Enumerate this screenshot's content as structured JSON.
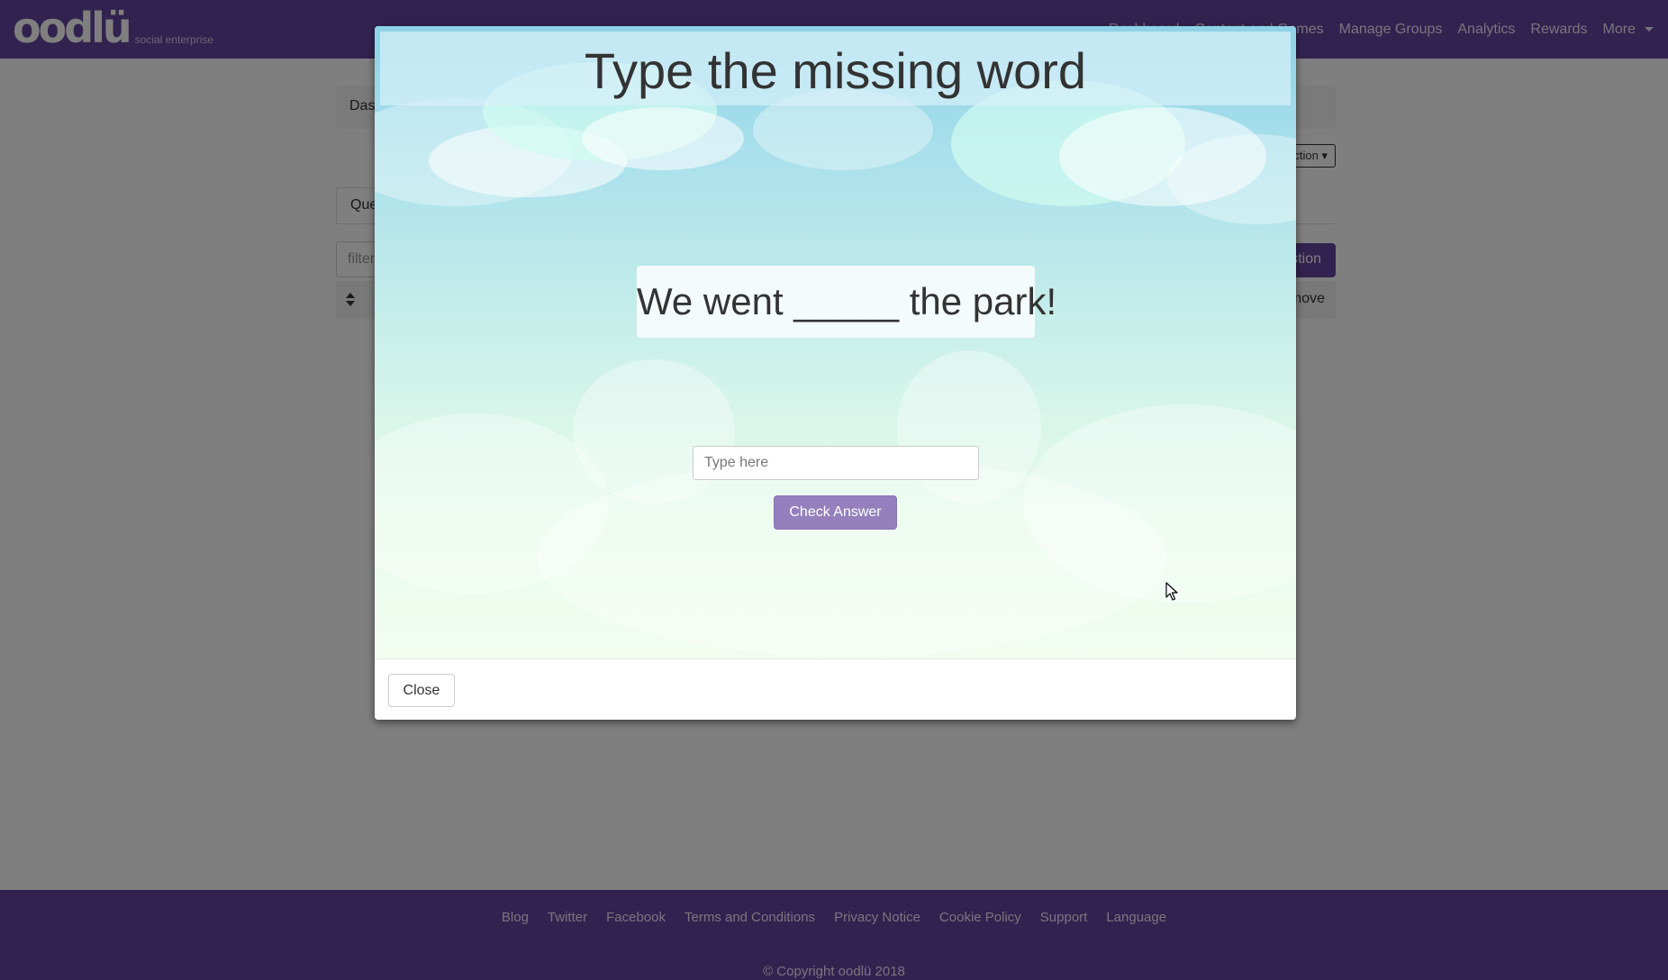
{
  "navbar": {
    "brand_logo": "oodlü",
    "brand_tagline": "social enterprise",
    "links": [
      {
        "label": "Dashboard"
      },
      {
        "label": "Content and Games"
      },
      {
        "label": "Manage Groups"
      },
      {
        "label": "Analytics"
      },
      {
        "label": "Rewards"
      },
      {
        "label": "More"
      }
    ]
  },
  "page": {
    "breadcrumb": "Dashboard",
    "action_dropdown": "Action",
    "tab_label": "Questions",
    "filter_placeholder": "filter",
    "add_button": "Add Question",
    "table_remove_header": "Remove"
  },
  "modal": {
    "title": "Type the missing word",
    "sentence": "We went _____ the park!",
    "input_placeholder": "Type here",
    "input_value": "",
    "check_button": "Check Answer",
    "close_button": "Close"
  },
  "footer": {
    "links": [
      {
        "label": "Blog"
      },
      {
        "label": "Twitter"
      },
      {
        "label": "Facebook"
      },
      {
        "label": "Terms and Conditions"
      },
      {
        "label": "Privacy Notice"
      },
      {
        "label": "Cookie Policy"
      },
      {
        "label": "Support"
      },
      {
        "label": "Language"
      }
    ],
    "copyright": "© Copyright oodlü 2018"
  },
  "colors": {
    "brand_purple": "#65459e",
    "check_button": "#9580bd",
    "text_dark": "#333333"
  }
}
